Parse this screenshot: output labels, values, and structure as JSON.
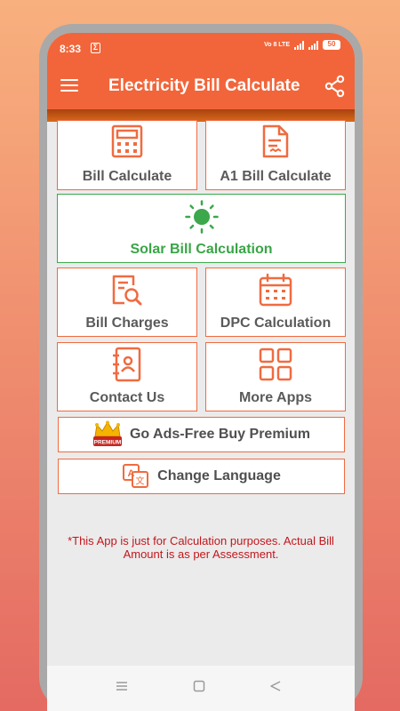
{
  "status_bar": {
    "time": "8:33",
    "notification_glyph": "Σ",
    "network_label": "Vo 8 LTE",
    "battery": "50"
  },
  "app_bar": {
    "title": "Electricity Bill Calculate",
    "menu_icon": "hamburger-menu-icon",
    "share_icon": "share-icon"
  },
  "tiles": {
    "bill_calculate": "Bill Calculate",
    "a1_bill_calculate": "A1 Bill Calculate",
    "solar_bill_calculation": "Solar Bill Calculation",
    "bill_charges": "Bill Charges",
    "dpc_calculation": "DPC Calculation",
    "contact_us": "Contact Us",
    "more_apps": "More Apps"
  },
  "premium": {
    "label": "Go Ads-Free Buy Premium",
    "badge_text": "PREMIUM"
  },
  "language": {
    "label": "Change Language",
    "icon_letter_a": "A",
    "icon_letter_x": "文"
  },
  "disclaimer": "*This App is just for Calculation purposes. Actual Bill Amount is as per Assessment.",
  "colors": {
    "accent": "#f2653a",
    "tile_border": "#f06b40",
    "solar_green": "#3aa84b",
    "disclaimer_red": "#c4161c"
  }
}
